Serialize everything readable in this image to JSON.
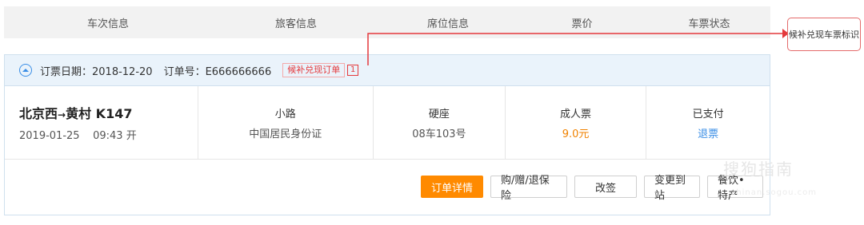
{
  "header": {
    "columns": [
      "车次信息",
      "旅客信息",
      "席位信息",
      "票价",
      "车票状态"
    ]
  },
  "order": {
    "date_label": "订票日期：2018-12-20",
    "order_no_label": "订单号：E666666666",
    "tag": "候补兑现订单",
    "badge": "1"
  },
  "ticket": {
    "route": "北京西",
    "arrow": "→",
    "to": "黄村",
    "train": "K147",
    "date": "2019-01-25",
    "time": "09:43 开",
    "passenger_name": "小路",
    "id_type": "中国居民身份证",
    "seat_type": "硬座",
    "seat_no": "08车103号",
    "ticket_type": "成人票",
    "price": "9.0元",
    "status": "已支付",
    "refund": "退票"
  },
  "actions": {
    "details": "订单详情",
    "insurance": "购/赠/退保险",
    "change": "改签",
    "change_station": "变更到站",
    "food": "餐饮•特产"
  },
  "callout": {
    "text": "候补兑现车票标识"
  },
  "watermark": {
    "main": "搜狗指南",
    "url": "zhinan.sogou.com"
  },
  "colors": {
    "accent_orange": "#ff8a00",
    "red": "#e4393c",
    "blue": "#3a8ee6"
  }
}
